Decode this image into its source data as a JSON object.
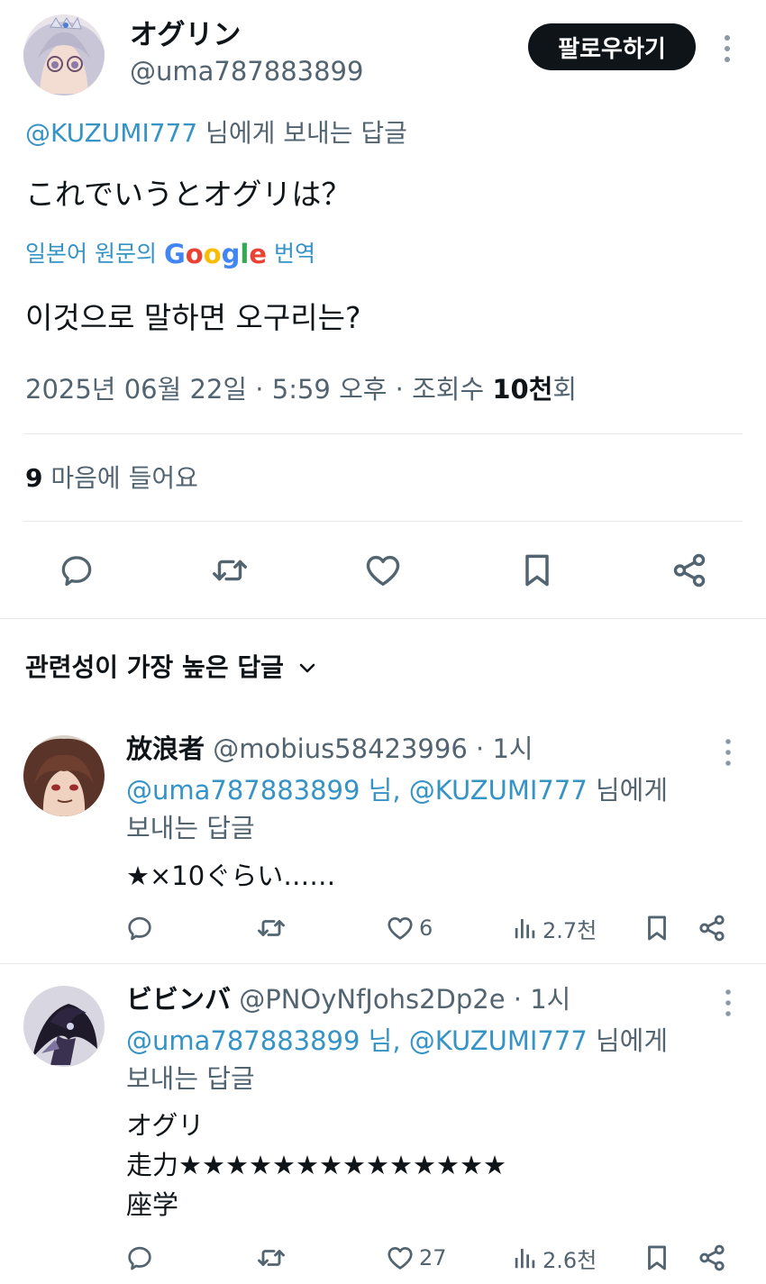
{
  "main_tweet": {
    "author_name": "オグリン",
    "author_handle": "@uma787883899",
    "follow_label": "팔로우하기",
    "replying_handle": "@KUZUMI777",
    "replying_suffix": " 님에게 보내는 답글",
    "text": "これでいうとオグリは？",
    "translate_prefix": "일본어 원문의",
    "translate_brand": "Google",
    "translate_suffix": "번역",
    "translated_text": "이것으로 말하면 오구리는?",
    "meta_date": "2025년 06월 22일 · 5:59 오후 · 조회수 ",
    "meta_views": "10천",
    "meta_views_suffix": "회",
    "likes_count": "9",
    "likes_label": " 마음에 들어요",
    "icons": [
      "reply-icon",
      "retweet-icon",
      "like-icon",
      "bookmark-icon",
      "share-icon"
    ]
  },
  "replies_sort_label": "관련성이 가장 높은 답글",
  "replies": [
    {
      "name": "放浪者",
      "handle": "@mobius58423996",
      "time": "· 1시",
      "reply_handles": "@uma787883899 님, @KUZUMI777",
      "reply_suffix": " 님에게",
      "reply_line2": "보내는 답글",
      "lines": [
        "★×10ぐらい……"
      ],
      "likes": "6",
      "views": "2.7천"
    },
    {
      "name": "ビビンバ",
      "handle": "@PNOyNfJohs2Dp2e",
      "time": "· 1시",
      "reply_handles": "@uma787883899 님, @KUZUMI777",
      "reply_suffix": " 님에게",
      "reply_line2": "보내는 답글",
      "lines": [
        "オグリ",
        "走力★★★★★★★★★★★★★★",
        "座学"
      ],
      "likes": "27",
      "views": "2.6천"
    }
  ],
  "colors": {
    "text": "#0f1419",
    "muted": "#536471",
    "link": "#3593c6",
    "follow_bg": "#0f1419"
  }
}
